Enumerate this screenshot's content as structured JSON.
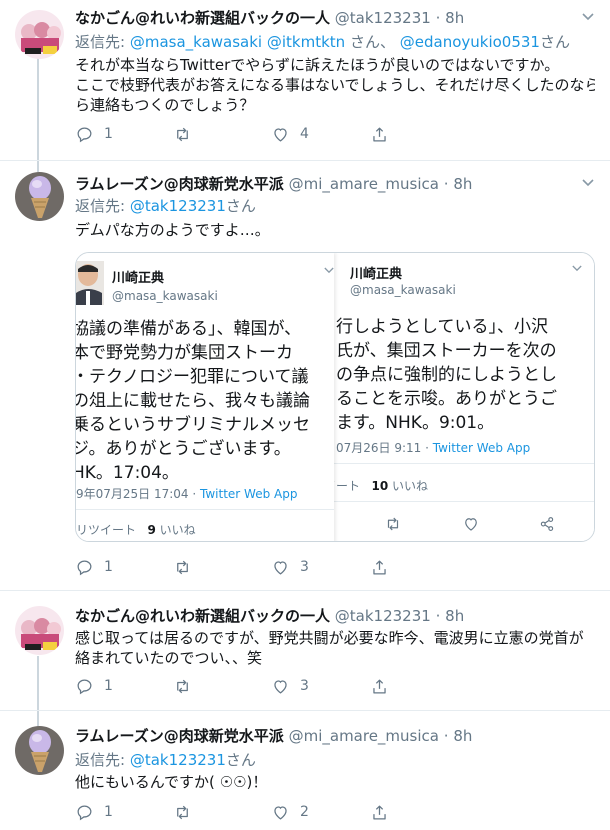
{
  "tweets": [
    {
      "name": "なかごん@れいわ新選組バックの一人",
      "handle": "@tak123231",
      "dot": "·",
      "time": "8h",
      "reply_label": "返信先:",
      "reply_mentions": [
        "@masa_kawasaki",
        "@itkmtktn",
        "さん、",
        "@edanoyukio0531",
        "さん"
      ],
      "text_lines": [
        "それが本当ならTwitterでやらずに訴えたほうが良いのではないですか。",
        "ここで枝野代表がお答えになる事はないでしょうし、それだけ尽くしたのなら",
        "ら連絡もつくのでしょう？"
      ],
      "reply_count": "1",
      "retweet_count": "",
      "like_count": "4"
    },
    {
      "name": "ラムレーズン@肉球新党水平派",
      "handle": "@mi_amare_musica",
      "dot": "·",
      "time": "8h",
      "reply_label": "返信先:",
      "reply_mention": "@tak123231",
      "reply_suffix": "さん",
      "text": "デムパな方のようですよ…。",
      "reply_count": "1",
      "retweet_count": "",
      "like_count": "3"
    },
    {
      "name": "なかごん@れいわ新選組バックの一人",
      "handle": "@tak123231",
      "dot": "·",
      "time": "8h",
      "text_lines": [
        "感じ取っては居るのですが、野党共闘が必要な昨今、電波男に立憲の党首が",
        "絡まれていたのでつい、、笑"
      ],
      "reply_count": "1",
      "retweet_count": "",
      "like_count": "3"
    },
    {
      "name": "ラムレーズン@肉球新党水平派",
      "handle": "@mi_amare_musica",
      "dot": "·",
      "time": "8h",
      "reply_label": "返信先:",
      "reply_mention": "@tak123231",
      "reply_suffix": "さん",
      "text": "他にもいるんですか( ☉☉)！",
      "reply_count": "1",
      "retweet_count": "",
      "like_count": "2"
    }
  ],
  "embedded": {
    "left": {
      "name": "川崎正典",
      "handle": "@masa_kawasaki",
      "text_lines": [
        "協議の準備がある」、韓国が、",
        "本で野党勢力が集団ストーカ",
        "・テクノロジー犯罪について議",
        "の俎上に載せたら、我々も議論",
        "乗るというサブリミナルメッセ",
        "ジ。ありがとうございます。",
        "HK。17:04。"
      ],
      "meta_date": "9年07月25日 17:04 · ",
      "meta_app": "Twitter Web App",
      "stats_retweet": "リツイート",
      "stats_like_count": "9",
      "stats_like_label": "いいね"
    },
    "right": {
      "name": "川崎正典",
      "handle": "@masa_kawasaki",
      "text_lines": [
        "行しようとしている」、小沢",
        "氏が、集団ストーカーを次の",
        "の争点に強制的にしようとし",
        "ることを示唆。ありがとうご",
        "ます。NHK。9:01。"
      ],
      "meta_date": "07月26日 9:11 · ",
      "meta_app": "Twitter Web App",
      "stats_retweet": "イート",
      "stats_like_count": "10",
      "stats_like_label": "いいね"
    }
  },
  "icons": {
    "reply": "reply-icon",
    "retweet": "retweet-icon",
    "like": "heart-icon",
    "share": "share-icon",
    "caret": "chevron-down-icon"
  },
  "colors": {
    "link": "#1b95e0",
    "secondary": "#657786",
    "thread_line": "#ccd6dd"
  }
}
